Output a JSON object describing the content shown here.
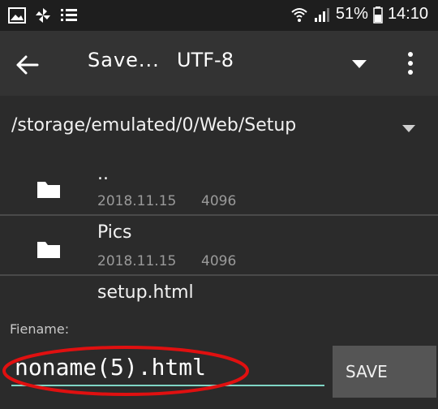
{
  "status_bar": {
    "battery_percent": "51%",
    "time": "14:10",
    "icons": [
      "image-icon",
      "pinwheel-icon",
      "list-icon",
      "wifi-icon",
      "signal-icon",
      "battery-icon"
    ]
  },
  "app_bar": {
    "title": "Save...",
    "encoding": "UTF-8"
  },
  "path": {
    "current": "/storage/emulated/0/Web/Setup"
  },
  "files": [
    {
      "name": "..",
      "date": "2018.11.15",
      "size": "4096",
      "type": "folder"
    },
    {
      "name": "Pics",
      "date": "2018.11.15",
      "size": "4096",
      "type": "folder"
    },
    {
      "name": "setup.html",
      "type": "file"
    }
  ],
  "filename": {
    "label": "Fiename:",
    "value": "noname(5).html"
  },
  "buttons": {
    "save_label": "SAVE"
  },
  "colors": {
    "background": "#2b2b2b",
    "app_bar": "#333333",
    "accent_underline": "#7fd6c6",
    "annotation_red": "#e01010",
    "save_button": "#555555"
  }
}
